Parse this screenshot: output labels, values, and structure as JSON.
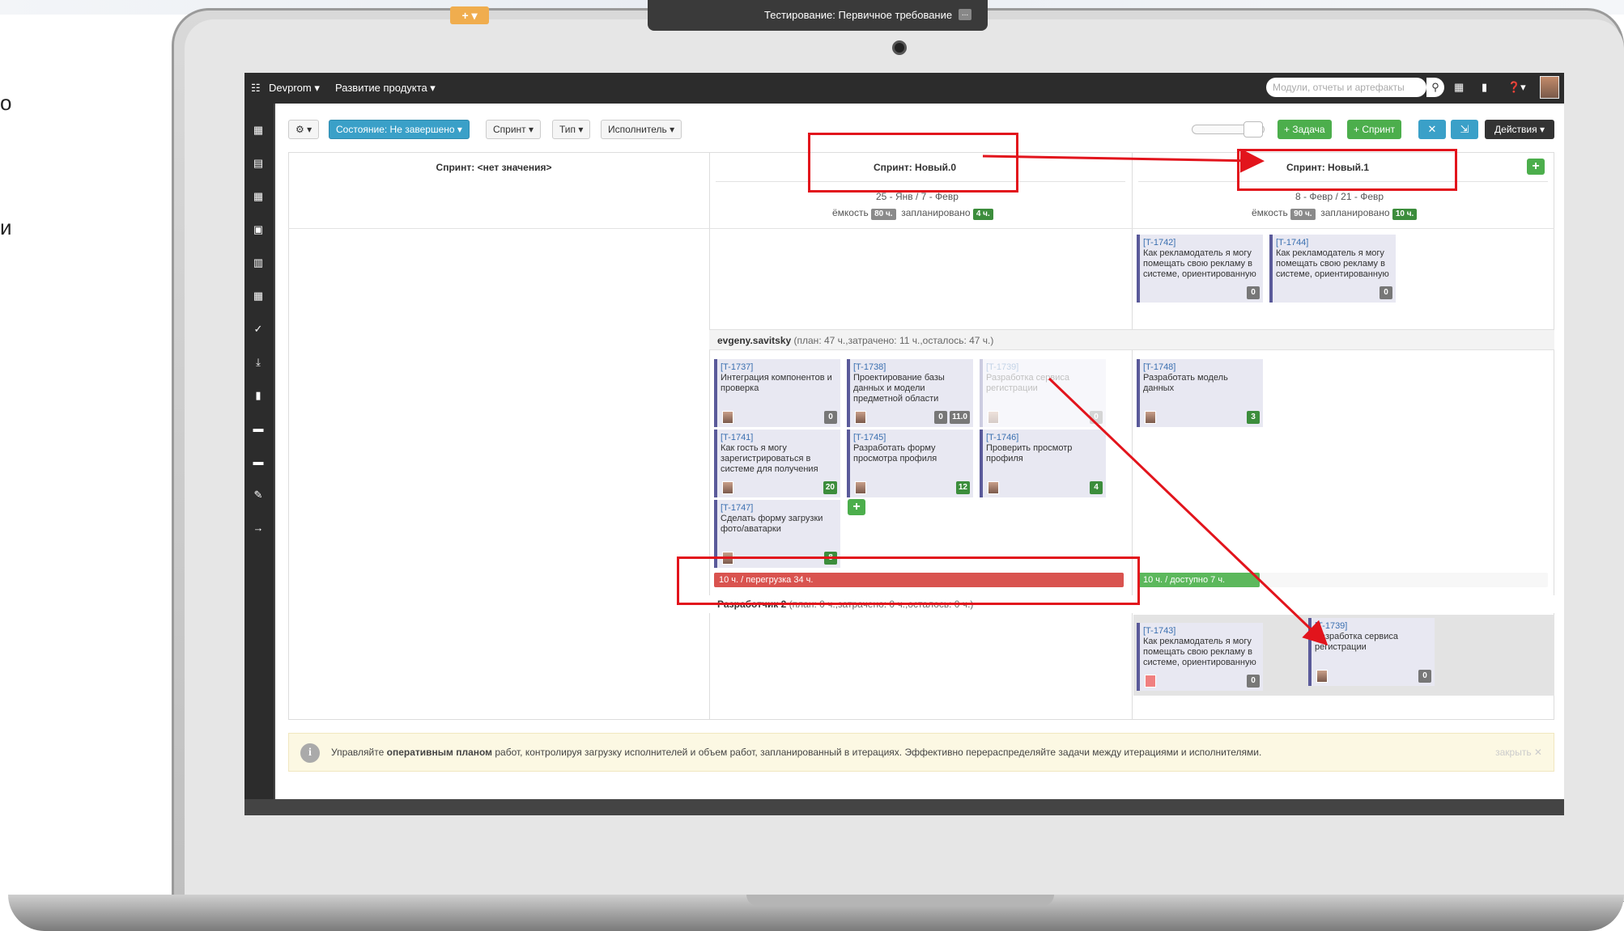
{
  "side_text": [
    "о",
    "и"
  ],
  "topbar": {
    "menu_icon": "grid-menu-icon",
    "project": "Devprom ▾",
    "section": "Развитие продукта ▾",
    "plus": "+ ▾",
    "page_title": "Тестирование: Первичное требование",
    "title_dots": "...",
    "search_placeholder": "Модули, отчеты и артефакты"
  },
  "filters": {
    "settings": "⚙ ▾",
    "state": "Состояние: Не завершено ▾",
    "sprint": "Спринт ▾",
    "type": "Тип ▾",
    "assignee": "Исполнитель ▾"
  },
  "actions": {
    "add_task": "+ Задача",
    "add_sprint": "+ Спринт",
    "actions_menu": "Действия ▾"
  },
  "columns": [
    {
      "title": "Спринт: <нет значения>"
    },
    {
      "title": "Спринт: Новый.0",
      "dates": "25 - Янв / 7 - Февр",
      "capacity_label": "ёмкость",
      "capacity": "80 ч.",
      "planned_label": "запланировано",
      "planned": "4 ч."
    },
    {
      "title": "Спринт: Новый.1",
      "dates": "8 - Февр / 21 - Февр",
      "capacity_label": "ёмкость",
      "capacity": "90 ч.",
      "planned_label": "запланировано",
      "planned": "10 ч."
    }
  ],
  "rows": {
    "row1_name": "evgeny.savitsky",
    "row1_stats": "(план: 47 ч.,затрачено: 11 ч.,осталось: 47 ч.)",
    "row2_name": "Разработчик 2",
    "row2_stats": "(план: 0 ч.,затрачено: 0 ч.,осталось: 0 ч.)"
  },
  "cards": {
    "c1742": {
      "id": "[T-1742]",
      "text": "Как рекламодатель я могу помещать свою рекламу в системе, ориентированную",
      "b1": "0"
    },
    "c1744": {
      "id": "[T-1744]",
      "text": "Как рекламодатель я могу помещать свою рекламу в системе, ориентированную",
      "b1": "0"
    },
    "c1737": {
      "id": "[T-1737]",
      "text": "Интеграция компонентов и проверка",
      "b1": "0"
    },
    "c1738": {
      "id": "[T-1738]",
      "text": "Проектирование базы данных и модели предметной области",
      "b1": "0",
      "b2": "11.0"
    },
    "c1739f": {
      "id": "[T-1739]",
      "text": "Разработка сервиса регистрации",
      "b1": "0"
    },
    "c1748": {
      "id": "[T-1748]",
      "text": "Разработать модель данных",
      "b1": "3"
    },
    "c1741": {
      "id": "[T-1741]",
      "text": "Как гость я могу зарегистрироваться в системе для получения",
      "b1": "20"
    },
    "c1745": {
      "id": "[T-1745]",
      "text": "Разработать форму просмотра профиля",
      "b1": "12"
    },
    "c1746": {
      "id": "[T-1746]",
      "text": "Проверить просмотр профиля",
      "b1": "4"
    },
    "c1747": {
      "id": "[T-1747]",
      "text": "Сделать форму загрузки фото/аватарки",
      "b1": "8"
    },
    "c1743": {
      "id": "[T-1743]",
      "text": "Как рекламодатель я могу помещать свою рекламу в системе, ориентированную",
      "b1": "0"
    },
    "c1739": {
      "id": "[T-1739]",
      "text": "Разработка сервиса регистрации",
      "b1": "0"
    }
  },
  "load": {
    "overload_text": "10 ч. / перегрузка 34 ч.",
    "overload_fraction": 1.0,
    "available_text": "10 ч. / доступно 7 ч.",
    "available_fraction": 0.3
  },
  "info": {
    "prefix": "Управляйте ",
    "bold": "оперативным планом",
    "rest": " работ, контролируя загрузку исполнителей и объем работ, запланированный в итерациях. Эффективно перераспределяйте задачи между итерациями и исполнителями.",
    "close": "закрыть ✕"
  },
  "colors": {
    "annotation_red": "#e2141c",
    "accent_blue": "#3aa0c8",
    "accent_green": "#4cae4c",
    "overload_red": "#d9534f"
  }
}
